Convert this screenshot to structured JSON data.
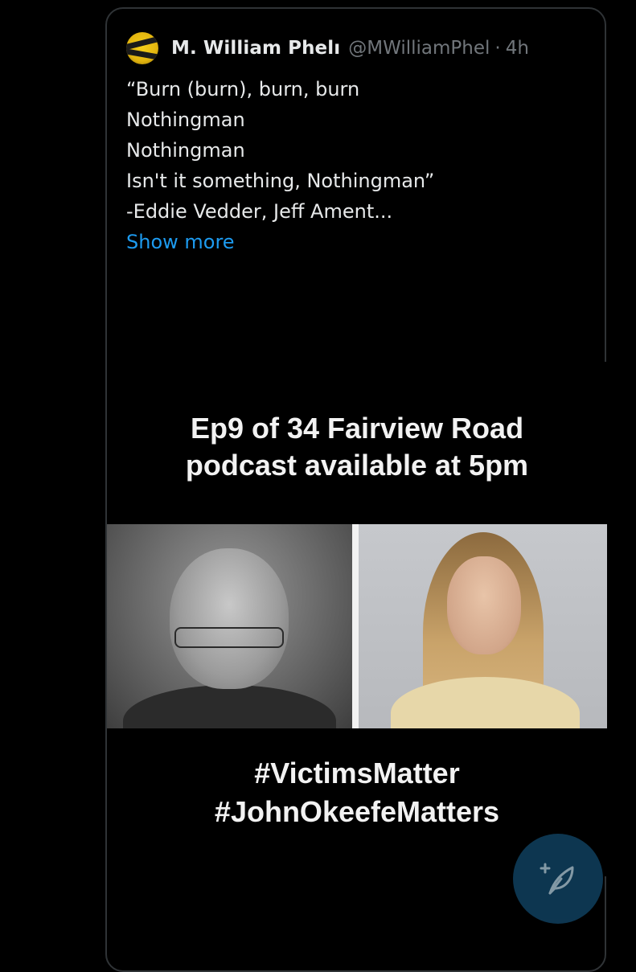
{
  "tweet": {
    "author_name": "M. William Phelı",
    "author_handle": "@MWilliamPhel",
    "separator": "·",
    "timestamp": "4h",
    "avatar_icon": "crossing-the-line-logo",
    "text_lines": [
      "“Burn (burn), burn, burn",
      "Nothingman",
      "Nothingman",
      "Isn't it something, Nothingman”",
      "-Eddie Vedder, Jeff Ament..."
    ],
    "show_more_label": "Show more",
    "link_color": "#1d9bf0"
  },
  "media": {
    "headline_lines": [
      "Ep9 of 34 Fairview Road",
      "podcast available at 5pm"
    ],
    "hashtags": [
      "#VictimsMatter",
      "#JohnOkeefeMatters"
    ]
  },
  "fab": {
    "icon": "compose-feather-plus-icon",
    "color": "#0f3b57"
  }
}
